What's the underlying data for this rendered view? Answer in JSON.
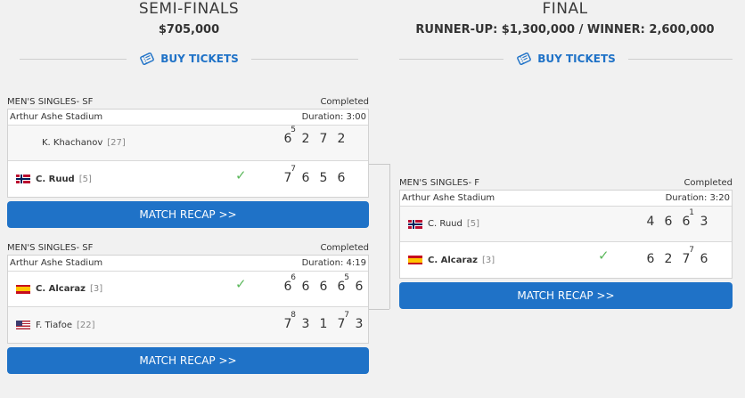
{
  "semi": {
    "title": "SEMI-FINALS",
    "prize": "$705,000",
    "tickets_label": "BUY TICKETS"
  },
  "final": {
    "title": "FINAL",
    "prize": "RUNNER-UP: $1,300,000 / WINNER: 2,600,000",
    "tickets_label": "BUY TICKETS"
  },
  "matches": [
    {
      "round": "MEN'S SINGLES- SF",
      "status": "Completed",
      "venue": "Arthur Ashe Stadium",
      "duration": "Duration: 3:00",
      "recap": "MATCH RECAP >>",
      "players": [
        {
          "name": "K. Khachanov",
          "seed": "[27]",
          "flag": "",
          "winner": false,
          "sets": [
            {
              "s": "6",
              "tb": "5"
            },
            {
              "s": "2"
            },
            {
              "s": "7"
            },
            {
              "s": "2"
            }
          ]
        },
        {
          "name": "C. Ruud",
          "seed": "[5]",
          "flag": "nor",
          "winner": true,
          "sets": [
            {
              "s": "7",
              "tb": "7"
            },
            {
              "s": "6"
            },
            {
              "s": "5"
            },
            {
              "s": "6"
            }
          ]
        }
      ]
    },
    {
      "round": "MEN'S SINGLES- SF",
      "status": "Completed",
      "venue": "Arthur Ashe Stadium",
      "duration": "Duration: 4:19",
      "recap": "MATCH RECAP >>",
      "players": [
        {
          "name": "C. Alcaraz",
          "seed": "[3]",
          "flag": "esp",
          "winner": true,
          "sets": [
            {
              "s": "6",
              "tb": "6"
            },
            {
              "s": "6"
            },
            {
              "s": "6"
            },
            {
              "s": "6",
              "tb": "5"
            },
            {
              "s": "6"
            }
          ]
        },
        {
          "name": "F. Tiafoe",
          "seed": "[22]",
          "flag": "usa",
          "winner": false,
          "sets": [
            {
              "s": "7",
              "tb": "8"
            },
            {
              "s": "3"
            },
            {
              "s": "1"
            },
            {
              "s": "7",
              "tb": "7"
            },
            {
              "s": "3"
            }
          ]
        }
      ]
    },
    {
      "round": "MEN'S SINGLES- F",
      "status": "Completed",
      "venue": "Arthur Ashe Stadium",
      "duration": "Duration: 3:20",
      "recap": "MATCH RECAP >>",
      "players": [
        {
          "name": "C. Ruud",
          "seed": "[5]",
          "flag": "nor",
          "winner": false,
          "sets": [
            {
              "s": "4"
            },
            {
              "s": "6"
            },
            {
              "s": "6",
              "tb": "1"
            },
            {
              "s": "3"
            }
          ]
        },
        {
          "name": "C. Alcaraz",
          "seed": "[3]",
          "flag": "esp",
          "winner": true,
          "sets": [
            {
              "s": "6"
            },
            {
              "s": "2"
            },
            {
              "s": "7",
              "tb": "7"
            },
            {
              "s": "6"
            }
          ]
        }
      ]
    }
  ],
  "icons": {
    "ticket": "ticket-icon",
    "check": "checkmark-icon"
  },
  "colors": {
    "accent": "#1f72c7",
    "check": "#5cb85c"
  }
}
